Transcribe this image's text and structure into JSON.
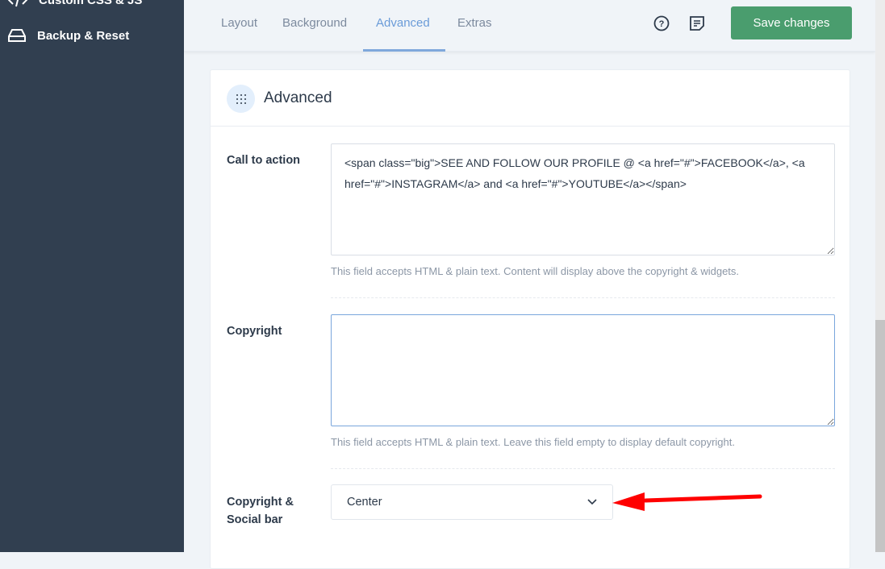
{
  "sidebar": {
    "items": [
      {
        "label": "Custom CSS & JS",
        "icon": "code-icon"
      },
      {
        "label": "Backup & Reset",
        "icon": "drive-icon"
      }
    ]
  },
  "header": {
    "tabs": [
      {
        "label": "Layout"
      },
      {
        "label": "Background"
      },
      {
        "label": "Advanced",
        "active": true
      },
      {
        "label": "Extras"
      }
    ],
    "save_label": "Save changes",
    "accent": "#6a9bd8",
    "save_color": "#4a9d6e"
  },
  "section": {
    "title": "Advanced",
    "cta": {
      "label": "Call to action",
      "value": "<span class=\"big\">SEE AND FOLLOW OUR PROFILE @ <a href=\"#\">FACEBOOK</a>, <a href=\"#\">INSTAGRAM</a> and <a href=\"#\">YOUTUBE</a></span>",
      "help": "This field accepts HTML & plain text. Content will display above the copyright & widgets."
    },
    "copyright": {
      "label": "Copyright",
      "value": "",
      "help": "This field accepts HTML & plain text. Leave this field empty to display default copyright."
    },
    "social": {
      "label_line1": "Copyright &",
      "label_line2": "Social bar",
      "value": "Center"
    }
  }
}
